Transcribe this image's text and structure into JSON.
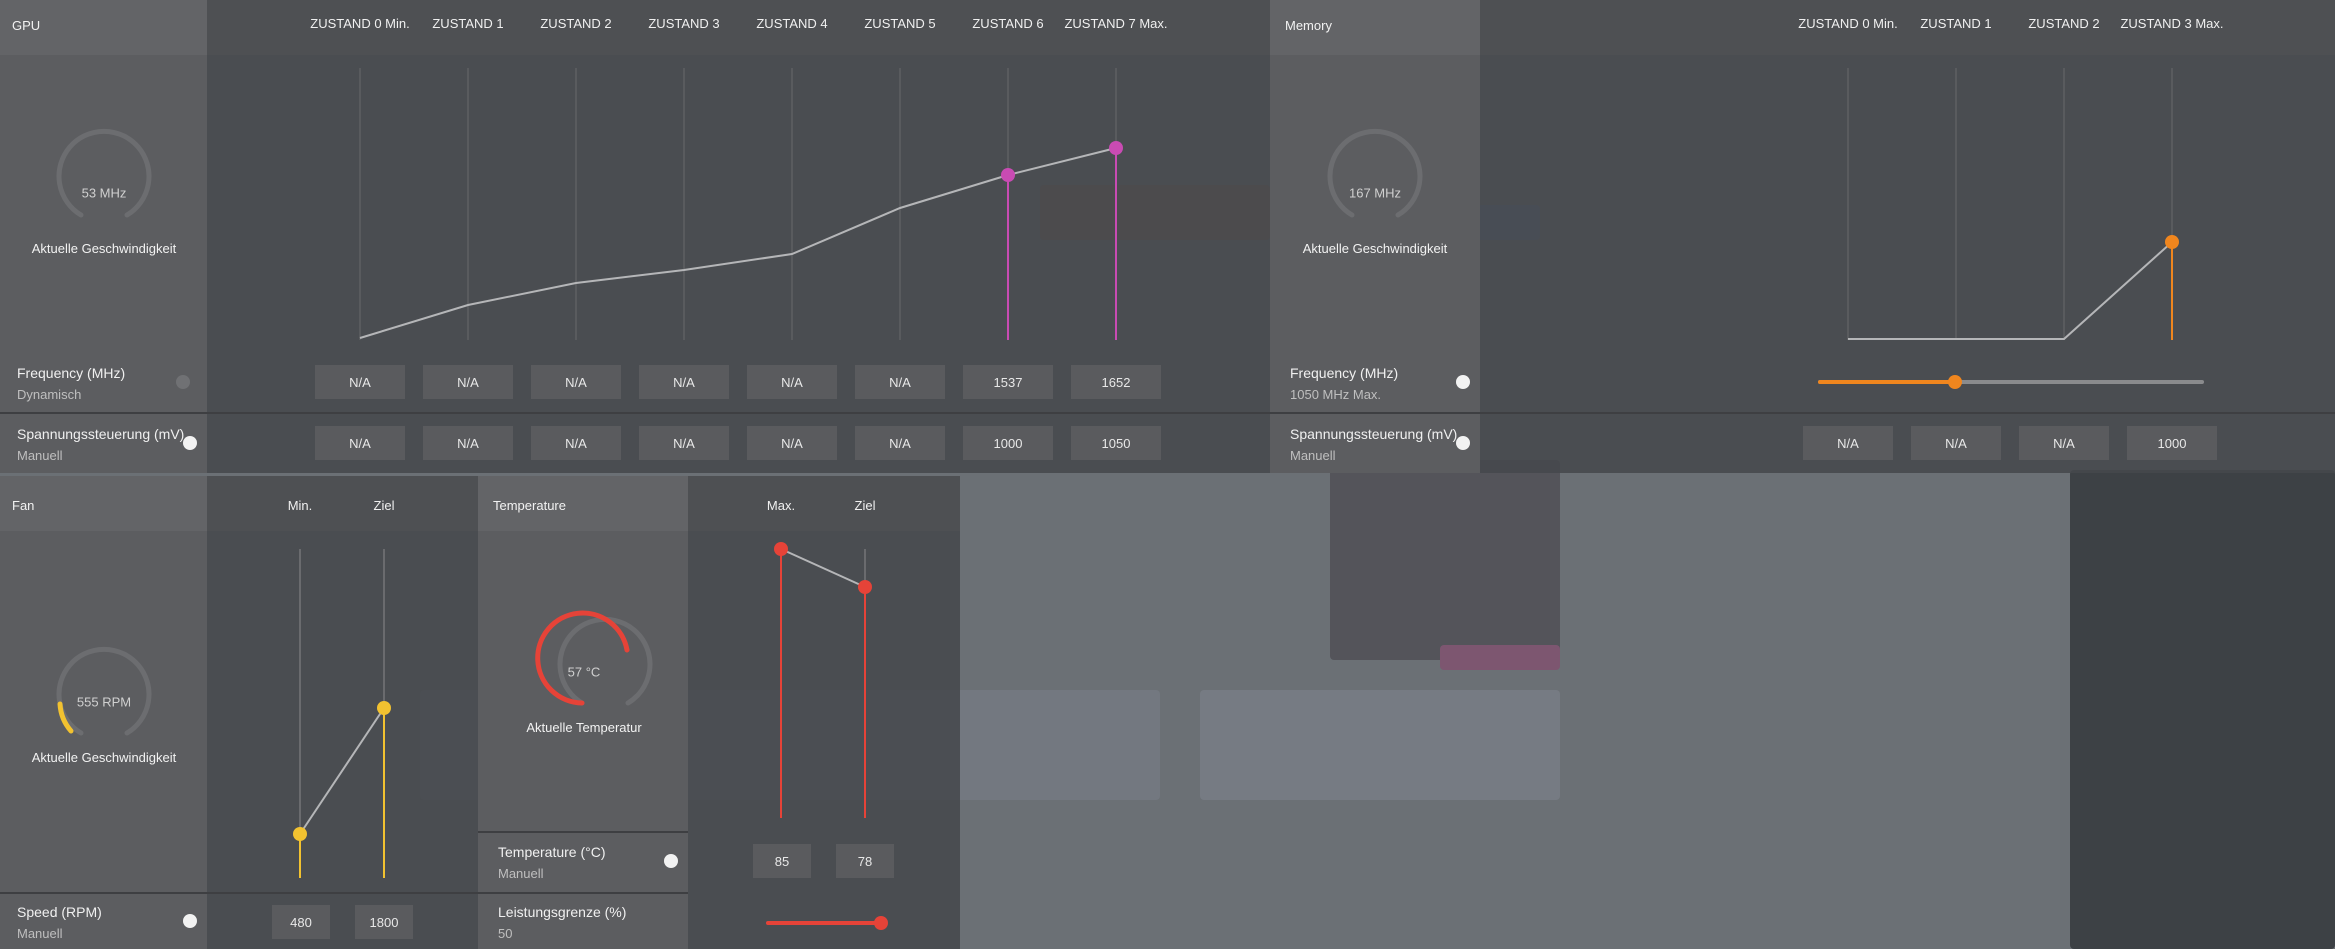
{
  "gpu": {
    "title": "GPU",
    "states": [
      "ZUSTAND 0 Min.",
      "ZUSTAND 1",
      "ZUSTAND 2",
      "ZUSTAND 3",
      "ZUSTAND 4",
      "ZUSTAND 5",
      "ZUSTAND 6",
      "ZUSTAND 7 Max."
    ],
    "gauge_value": "53 MHz",
    "gauge_label": "Aktuelle Geschwindigkeit",
    "frequency_label": "Frequency (MHz)",
    "frequency_mode": "Dynamisch",
    "voltage_label": "Spannungssteuerung (mV)",
    "voltage_mode": "Manuell",
    "frequency_values": [
      "N/A",
      "N/A",
      "N/A",
      "N/A",
      "N/A",
      "N/A",
      "1537",
      "1652"
    ],
    "voltage_values": [
      "N/A",
      "N/A",
      "N/A",
      "N/A",
      "N/A",
      "N/A",
      "1000",
      "1050"
    ],
    "accent_color": "#c94bb3"
  },
  "memory": {
    "title": "Memory",
    "states": [
      "ZUSTAND 0 Min.",
      "ZUSTAND 1",
      "ZUSTAND 2",
      "ZUSTAND 3 Max."
    ],
    "gauge_value": "167 MHz",
    "gauge_label": "Aktuelle Geschwindigkeit",
    "frequency_label": "Frequency (MHz)",
    "frequency_mode": "1050 MHz Max.",
    "frequency_slider": 0.35,
    "voltage_label": "Spannungssteuerung (mV)",
    "voltage_mode": "Manuell",
    "voltage_values": [
      "N/A",
      "N/A",
      "N/A",
      "1000"
    ],
    "accent_color": "#f0861e"
  },
  "fan": {
    "title": "Fan",
    "columns": [
      "Min.",
      "Ziel"
    ],
    "gauge_value": "555 RPM",
    "gauge_label": "Aktuelle Geschwindigkeit",
    "speed_label": "Speed (RPM)",
    "speed_mode": "Manuell",
    "values": [
      "480",
      "1800"
    ],
    "accent_color": "#f2c230"
  },
  "temperature": {
    "title": "Temperature",
    "columns": [
      "Max.",
      "Ziel"
    ],
    "gauge_value": "57 °C",
    "gauge_label": "Aktuelle Temperatur",
    "temp_label": "Temperature (°C)",
    "temp_mode": "Manuell",
    "values": [
      "85",
      "78"
    ],
    "power_label": "Leistungsgrenze (%)",
    "power_value": "50",
    "power_slider": 1.0,
    "accent_color": "#e64338"
  }
}
